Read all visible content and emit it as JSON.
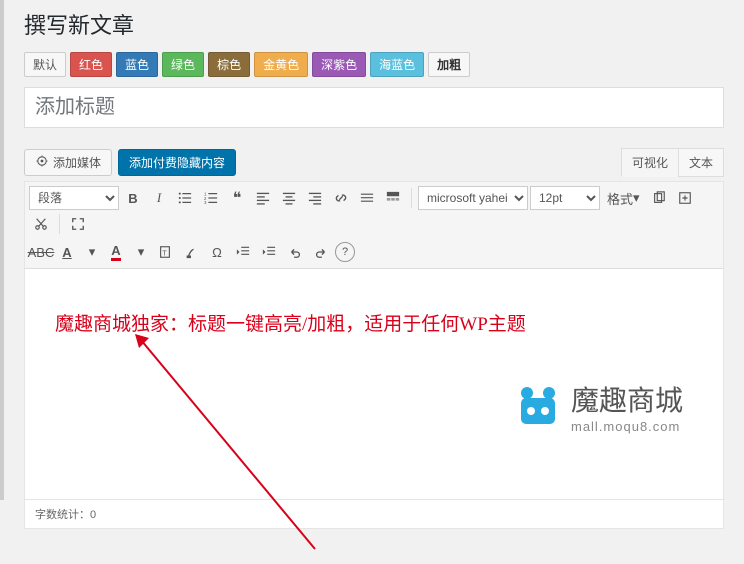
{
  "page_title": "撰写新文章",
  "color_buttons": [
    {
      "label": "默认",
      "bg": "#f7f7f7",
      "cls": "def"
    },
    {
      "label": "红色",
      "bg": "#d9534f"
    },
    {
      "label": "蓝色",
      "bg": "#337ab7"
    },
    {
      "label": "绿色",
      "bg": "#5cb85c"
    },
    {
      "label": "棕色",
      "bg": "#8a6d3b"
    },
    {
      "label": "金黄色",
      "bg": "#f0ad4e"
    },
    {
      "label": "深紫色",
      "bg": "#9b59b6"
    },
    {
      "label": "海蓝色",
      "bg": "#5bc0de"
    },
    {
      "label": "加粗",
      "bg": "#f7f7f7",
      "cls": "bold"
    }
  ],
  "title_placeholder": "添加标题",
  "media_button": "添加媒体",
  "paid_button": "添加付费隐藏内容",
  "tabs": {
    "visual": "可视化",
    "text": "文本"
  },
  "toolbar": {
    "paragraph": "段落",
    "font": "microsoft yahei",
    "size": "12pt",
    "format": "格式"
  },
  "editor_content": {
    "promo_text": "魔趣商城独家：标题一键高亮/加粗，适用于任何WP主题",
    "logo_name": "魔趣商城",
    "logo_url": "mall.moqu8.com"
  },
  "footer": {
    "word_count_label": "字数统计：",
    "word_count": "0"
  }
}
